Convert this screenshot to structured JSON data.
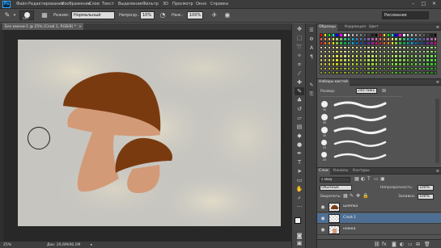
{
  "app": {
    "logo": "Ps"
  },
  "menu": [
    "Файл",
    "Редактирование",
    "Изображение",
    "Слои",
    "Текст",
    "Выделение",
    "Фильтр",
    "3D",
    "Просмотр",
    "Окно",
    "Справка"
  ],
  "window_controls": {
    "minimize": "–",
    "maximize": "□",
    "close": "✕"
  },
  "options": {
    "brush_size": "240",
    "mode_label": "Режим:",
    "mode_value": "Нормальный",
    "opacity_label": "Непрозр.:",
    "opacity_value": "10%",
    "pressure_label": "Наж.:",
    "pressure_value": "100%",
    "workspace": "Рисование"
  },
  "document": {
    "tab_title": "Без имени-1 @ 25% (Слой 1, RGB/8) *",
    "close": "×"
  },
  "status": {
    "zoom": "25%",
    "doc_info": "Док: 20,6M/46,1M"
  },
  "colors": {
    "canvas_bg": "#c8c6c0",
    "cap": "#7a3a10",
    "stem": "#d39a78",
    "accent": "#4e6f93"
  },
  "swatches_panel": {
    "tabs": [
      "Образцы",
      "Коррекция",
      "Цвет"
    ]
  },
  "brush_panel": {
    "tabs": [
      "Наборы кистей"
    ],
    "size_label": "Размер:",
    "size_value": "240 пикс.",
    "sizes": [
      "30",
      "30",
      "30",
      "25",
      "25"
    ]
  },
  "layers_panel": {
    "tabs": [
      "Слои",
      "Каналы",
      "Контуры"
    ],
    "filter_kind": "Вид",
    "blend_mode": "Обычные",
    "opacity_label": "Непрозрачность:",
    "opacity_value": "100%",
    "lock_label": "Закрепить:",
    "fill_label": "Заливка:",
    "fill_value": "100%",
    "layers": [
      {
        "name": "шляпка"
      },
      {
        "name": "Слой 1"
      },
      {
        "name": "ножка"
      }
    ]
  }
}
